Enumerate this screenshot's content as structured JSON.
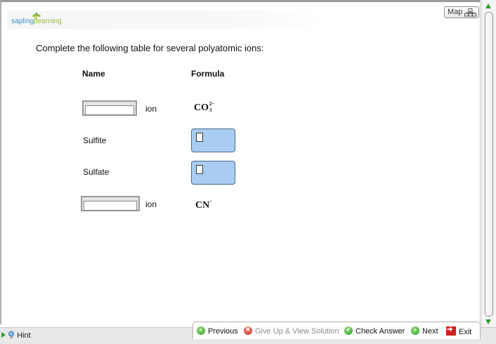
{
  "header": {
    "logo_part1": "sapling",
    "logo_part2": "learning",
    "map_label": "Map"
  },
  "question": {
    "instructions": "Complete the following table for several polyatomic ions:",
    "col_name": "Name",
    "col_formula": "Formula",
    "rows": [
      {
        "name_value": "",
        "suffix": "ion",
        "formula_base": "CO",
        "formula_sub": "3",
        "formula_sup": "2−"
      },
      {
        "name": "Sulfite",
        "formula_value": ""
      },
      {
        "name": "Sulfate",
        "formula_value": ""
      },
      {
        "name_value": "",
        "suffix": "ion",
        "formula_base": "CN",
        "formula_sup": "−"
      }
    ]
  },
  "footer": {
    "hint_label": "Hint",
    "previous_label": "Previous",
    "give_up_label": "Give Up & View Solution",
    "check_label": "Check Answer",
    "next_label": "Next",
    "exit_label": "Exit"
  },
  "colors": {
    "accent_green": "#2f9b2f",
    "brand_blue": "#3a8fc6",
    "brand_green": "#8fb93b",
    "chem_box": "#a9cdf1"
  },
  "icons": [
    "leaf-icon",
    "map-icon",
    "play-icon",
    "hint-bulb-icon",
    "previous-arrow-icon",
    "give-up-icon",
    "check-icon",
    "next-arrow-icon",
    "exit-door-icon",
    "scroll-up-arrow-icon",
    "scroll-down-arrow-icon"
  ]
}
